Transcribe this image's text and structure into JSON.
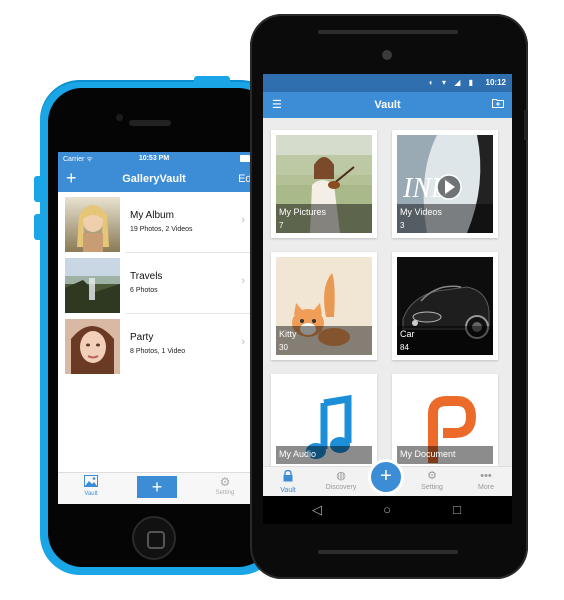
{
  "ios": {
    "status": {
      "carrier": "Carrier ᯤ",
      "time": "10:53 PM"
    },
    "nav": {
      "add_label": "+",
      "title": "GalleryVault",
      "edit_label": "Edi"
    },
    "albums": [
      {
        "name": "My Album",
        "count": "19 Photos, 2 Videos"
      },
      {
        "name": "Travels",
        "count": "6 Photos"
      },
      {
        "name": "Party",
        "count": "8 Photos, 1 Video"
      }
    ],
    "tabs": {
      "vault": "Vault",
      "add": "+",
      "setting": "Setting"
    },
    "accent": "#3d8dd6",
    "body_color": "#1aa6e6"
  },
  "android": {
    "status": {
      "time": "10:12"
    },
    "appbar": {
      "title": "Vault"
    },
    "cards": [
      {
        "title": "My Pictures",
        "count": "7"
      },
      {
        "title": "My Videos",
        "count": "3"
      },
      {
        "title": "Kitty",
        "count": "30"
      },
      {
        "title": "Car",
        "count": "84"
      },
      {
        "title": "My Audio",
        "count": ""
      },
      {
        "title": "My Document",
        "count": ""
      }
    ],
    "tabs": {
      "vault": "Vault",
      "discovery": "Discovery",
      "add": "+",
      "setting": "Setting",
      "more": "More"
    },
    "accent": "#3d8dd6"
  }
}
